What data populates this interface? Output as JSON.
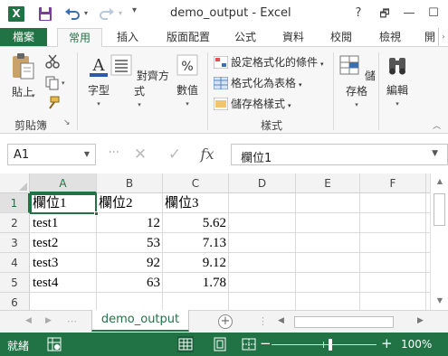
{
  "window": {
    "title": "demo_output - Excel",
    "help_label": "?",
    "restore_label": "🗗",
    "minimize_label": "—",
    "maximize_label": "☐",
    "close_label": "✕"
  },
  "qat": {
    "app_logo_letter": "X",
    "more_label": "▾"
  },
  "tabs": {
    "file": "檔案",
    "items": [
      "常用",
      "插入",
      "版面配置",
      "公式",
      "資料",
      "校閱",
      "檢視"
    ],
    "active": "常用",
    "overflow_label": "開"
  },
  "ribbon": {
    "paste_label": "貼上",
    "clipboard_group": "剪貼簿",
    "font_label": "字型",
    "align_label": "對齊方式",
    "number_label": "數值",
    "conditional_format": "設定格式化的條件",
    "format_as_table": "格式化為表格",
    "cell_styles": "儲存格樣式",
    "styles_group": "樣式",
    "cells_label": "儲存格",
    "editing_label": "編輯",
    "number_icon_glyph": "%",
    "font_icon_glyph": "A"
  },
  "formula_bar": {
    "name_box": "A1",
    "cancel_glyph": "✕",
    "enter_glyph": "✓",
    "fx_glyph": "fx",
    "content": "欄位1"
  },
  "sheet": {
    "columns": [
      "A",
      "B",
      "C",
      "D",
      "E",
      "F"
    ],
    "selected_column": "A",
    "rows": [
      "1",
      "2",
      "3",
      "4",
      "5",
      "6"
    ],
    "selected_row": "1",
    "active_cell": "A1",
    "header": [
      "欄位1",
      "欄位2",
      "欄位3"
    ],
    "data": [
      [
        "test1",
        "12",
        "5.62"
      ],
      [
        "test2",
        "53",
        "7.13"
      ],
      [
        "test3",
        "92",
        "9.12"
      ],
      [
        "test4",
        "63",
        "1.78"
      ]
    ]
  },
  "sheet_tabs": {
    "active": "demo_output",
    "nav_dots": "⋯",
    "add_label": "+"
  },
  "status": {
    "ready": "就緒",
    "zoom_percent": "100%",
    "zoom_minus": "−",
    "zoom_plus": "+"
  },
  "colors": {
    "excel_green": "#217346",
    "status_green": "#217346",
    "gridline": "#dadada"
  }
}
